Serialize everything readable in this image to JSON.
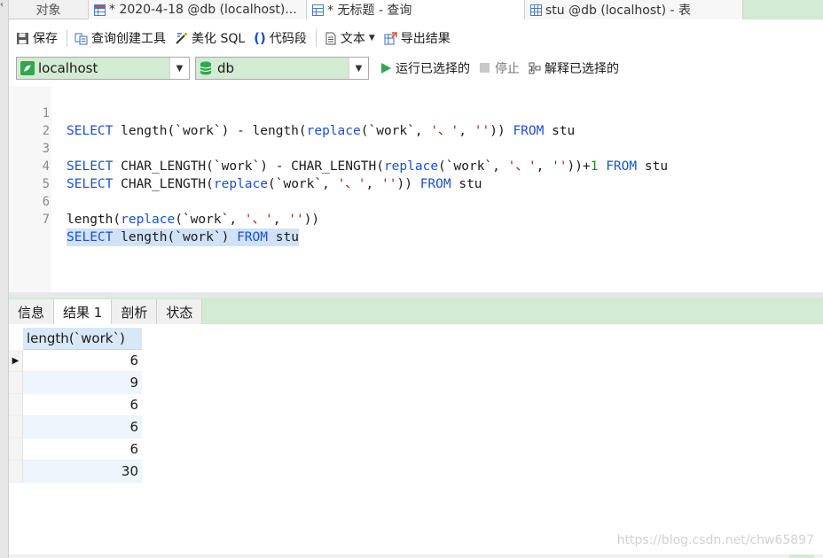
{
  "tabs": [
    {
      "label": "对象",
      "icon": "none"
    },
    {
      "label": "* 2020-4-18 @db (localhost)...",
      "icon": "grid-icon"
    },
    {
      "label": "* 无标题 - 查询",
      "icon": "query-icon"
    },
    {
      "label": "stu @db (localhost) - 表",
      "icon": "table-icon"
    }
  ],
  "toolbar": {
    "save": "保存",
    "query_builder": "查询创建工具",
    "beautify": "美化 SQL",
    "snippet": "代码段",
    "text": "文本",
    "export": "导出结果"
  },
  "connection": {
    "server": "localhost",
    "database": "db",
    "run_selected": "运行已选择的",
    "stop": "停止",
    "explain_selected": "解释已选择的"
  },
  "editor": {
    "lines": [
      {
        "num": "1",
        "text": "SELECT length(`work`) - length(replace(`work`, '、', '')) FROM stu"
      },
      {
        "num": "2",
        "text": ""
      },
      {
        "num": "3",
        "text": "SELECT CHAR_LENGTH(`work`) - CHAR_LENGTH(replace(`work`, '、', ''))+1 FROM stu"
      },
      {
        "num": "4",
        "text": "SELECT CHAR_LENGTH(replace(`work`, '、', '')) FROM stu"
      },
      {
        "num": "5",
        "text": ""
      },
      {
        "num": "6",
        "text": "length(replace(`work`, '、', ''))"
      },
      {
        "num": "7",
        "text": "SELECT length(`work`) FROM stu"
      }
    ]
  },
  "result_tabs": [
    "信息",
    "结果 1",
    "剖析",
    "状态"
  ],
  "grid": {
    "column": "length(`work`)",
    "rows": [
      "6",
      "9",
      "6",
      "6",
      "6",
      "30"
    ]
  },
  "watermark": "https://blog.csdn.net/chw65897",
  "colors": {
    "accent_green": "#d3ead3",
    "keyword_blue": "#1a4fd6",
    "string_red": "#b11e1e",
    "number_green": "#1a8a1a",
    "selection": "#cfe2f6"
  }
}
